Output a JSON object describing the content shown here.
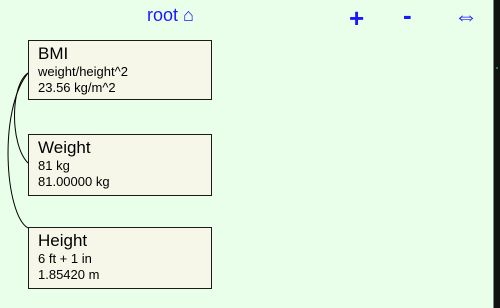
{
  "toolbar": {
    "root_label": "root ⌂",
    "zoom_in_label": "+",
    "zoom_out_label": "-",
    "swap_label": "⇔"
  },
  "nodes": [
    {
      "title": "BMI",
      "formula": "weight/height^2",
      "value": "23.56 kg/m^2"
    },
    {
      "title": "Weight",
      "formula": "81 kg",
      "value": "81.00000 kg"
    },
    {
      "title": "Height",
      "formula": "6 ft + 1 in",
      "value": "1.85420 m"
    }
  ]
}
